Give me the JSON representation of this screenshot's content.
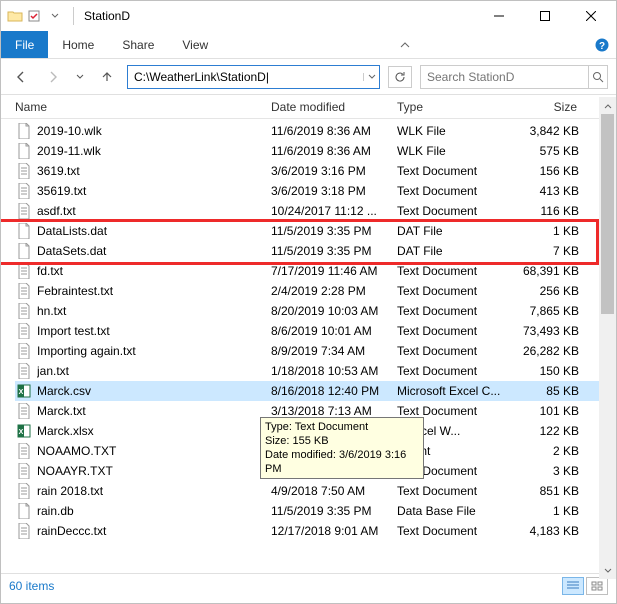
{
  "titlebar": {
    "title": "StationD"
  },
  "tabs": {
    "file": "File",
    "home": "Home",
    "share": "Share",
    "view": "View"
  },
  "nav": {
    "path": "C:\\WeatherLink\\StationD|",
    "search_placeholder": "Search StationD"
  },
  "columns": {
    "name": "Name",
    "date": "Date modified",
    "type": "Type",
    "size": "Size"
  },
  "files": [
    {
      "icon": "wlk",
      "name": "2019-10.wlk",
      "date": "11/6/2019 8:36 AM",
      "type": "WLK File",
      "size": "3,842 KB"
    },
    {
      "icon": "wlk",
      "name": "2019-11.wlk",
      "date": "11/6/2019 8:36 AM",
      "type": "WLK File",
      "size": "575 KB"
    },
    {
      "icon": "txt",
      "name": "3619.txt",
      "date": "3/6/2019 3:16 PM",
      "type": "Text Document",
      "size": "156 KB"
    },
    {
      "icon": "txt",
      "name": "35619.txt",
      "date": "3/6/2019 3:18 PM",
      "type": "Text Document",
      "size": "413 KB"
    },
    {
      "icon": "txt",
      "name": "asdf.txt",
      "date": "10/24/2017 11:12 ...",
      "type": "Text Document",
      "size": "116 KB"
    },
    {
      "icon": "dat",
      "name": "DataLists.dat",
      "date": "11/5/2019 3:35 PM",
      "type": "DAT File",
      "size": "1 KB"
    },
    {
      "icon": "dat",
      "name": "DataSets.dat",
      "date": "11/5/2019 3:35 PM",
      "type": "DAT File",
      "size": "7 KB"
    },
    {
      "icon": "txt",
      "name": "fd.txt",
      "date": "7/17/2019 11:46 AM",
      "type": "Text Document",
      "size": "68,391 KB"
    },
    {
      "icon": "txt",
      "name": "Febraintest.txt",
      "date": "2/4/2019 2:28 PM",
      "type": "Text Document",
      "size": "256 KB"
    },
    {
      "icon": "txt",
      "name": "hn.txt",
      "date": "8/20/2019 10:03 AM",
      "type": "Text Document",
      "size": "7,865 KB"
    },
    {
      "icon": "txt",
      "name": "Import test.txt",
      "date": "8/6/2019 10:01 AM",
      "type": "Text Document",
      "size": "73,493 KB"
    },
    {
      "icon": "txt",
      "name": "Importing again.txt",
      "date": "8/9/2019 7:34 AM",
      "type": "Text Document",
      "size": "26,282 KB"
    },
    {
      "icon": "txt",
      "name": "jan.txt",
      "date": "1/18/2018 10:53 AM",
      "type": "Text Document",
      "size": "150 KB"
    },
    {
      "icon": "xls",
      "name": "Marck.csv",
      "date": "8/16/2018 12:40 PM",
      "type": "Microsoft Excel C...",
      "size": "85 KB",
      "selected": true
    },
    {
      "icon": "txt",
      "name": "Marck.txt",
      "date": "3/13/2018 7:13 AM",
      "type": "Text Document",
      "size": "101 KB"
    },
    {
      "icon": "xls",
      "name": "Marck.xlsx",
      "date": "",
      "type": "ft Excel W...",
      "size": "122 KB"
    },
    {
      "icon": "txt",
      "name": "NOAAMO.TXT",
      "date": "",
      "type": "ument",
      "size": "2 KB"
    },
    {
      "icon": "txt",
      "name": "NOAAYR.TXT",
      "date": "9/11/2019 11:17 AM",
      "type": "Text Document",
      "size": "3 KB"
    },
    {
      "icon": "txt",
      "name": "rain 2018.txt",
      "date": "4/9/2018 7:50 AM",
      "type": "Text Document",
      "size": "851 KB"
    },
    {
      "icon": "db",
      "name": "rain.db",
      "date": "11/5/2019 3:35 PM",
      "type": "Data Base File",
      "size": "1 KB"
    },
    {
      "icon": "txt",
      "name": "rainDeccc.txt",
      "date": "12/17/2018 9:01 AM",
      "type": "Text Document",
      "size": "4,183 KB"
    }
  ],
  "tooltip": {
    "line1": "Type: Text Document",
    "line2": "Size: 155 KB",
    "line3": "Date modified: 3/6/2019 3:16 PM"
  },
  "status": {
    "count": "60 items"
  }
}
